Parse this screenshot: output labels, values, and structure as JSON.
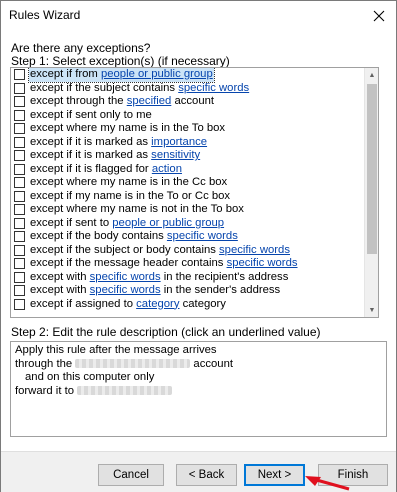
{
  "window": {
    "title": "Rules Wizard"
  },
  "header": {
    "question": "Are there any exceptions?",
    "step1": "Step 1: Select exception(s) (if necessary)"
  },
  "exceptions": [
    {
      "pre": "except if from ",
      "link": "people or public group",
      "post": ""
    },
    {
      "pre": "except if the subject contains ",
      "link": "specific words",
      "post": ""
    },
    {
      "pre": "except through the ",
      "link": "specified",
      "post": " account"
    },
    {
      "pre": "except if sent only to me",
      "link": "",
      "post": ""
    },
    {
      "pre": "except where my name is in the To box",
      "link": "",
      "post": ""
    },
    {
      "pre": "except if it is marked as ",
      "link": "importance",
      "post": ""
    },
    {
      "pre": "except if it is marked as ",
      "link": "sensitivity",
      "post": ""
    },
    {
      "pre": "except if it is flagged for ",
      "link": "action",
      "post": ""
    },
    {
      "pre": "except where my name is in the Cc box",
      "link": "",
      "post": ""
    },
    {
      "pre": "except if my name is in the To or Cc box",
      "link": "",
      "post": ""
    },
    {
      "pre": "except where my name is not in the To box",
      "link": "",
      "post": ""
    },
    {
      "pre": "except if sent to ",
      "link": "people or public group",
      "post": ""
    },
    {
      "pre": "except if the body contains ",
      "link": "specific words",
      "post": ""
    },
    {
      "pre": "except if the subject or body contains ",
      "link": "specific words",
      "post": ""
    },
    {
      "pre": "except if the message header contains ",
      "link": "specific words",
      "post": ""
    },
    {
      "pre": "except with ",
      "link": "specific words",
      "post": " in the recipient's address"
    },
    {
      "pre": "except with ",
      "link": "specific words",
      "post": " in the sender's address"
    },
    {
      "pre": "except if assigned to ",
      "link": "category",
      "post": " category"
    }
  ],
  "step2": {
    "label": "Step 2: Edit the rule description (click an underlined value)",
    "line1": "Apply this rule after the message arrives",
    "line2_pre": "through the ",
    "line2_post": " account",
    "line3": "and on this computer only",
    "line4_pre": "forward it to "
  },
  "buttons": {
    "cancel": "Cancel",
    "back": "< Back",
    "next": "Next >",
    "finish": "Finish"
  },
  "icons": {
    "close": "close-icon",
    "scroll_up": "scroll-up-arrow-icon",
    "scroll_down": "scroll-down-arrow-icon"
  },
  "colors": {
    "link": "#0645ad",
    "selection": "#cce4f7",
    "default_button_border": "#0078d7",
    "annotation_arrow": "#e0101e"
  }
}
